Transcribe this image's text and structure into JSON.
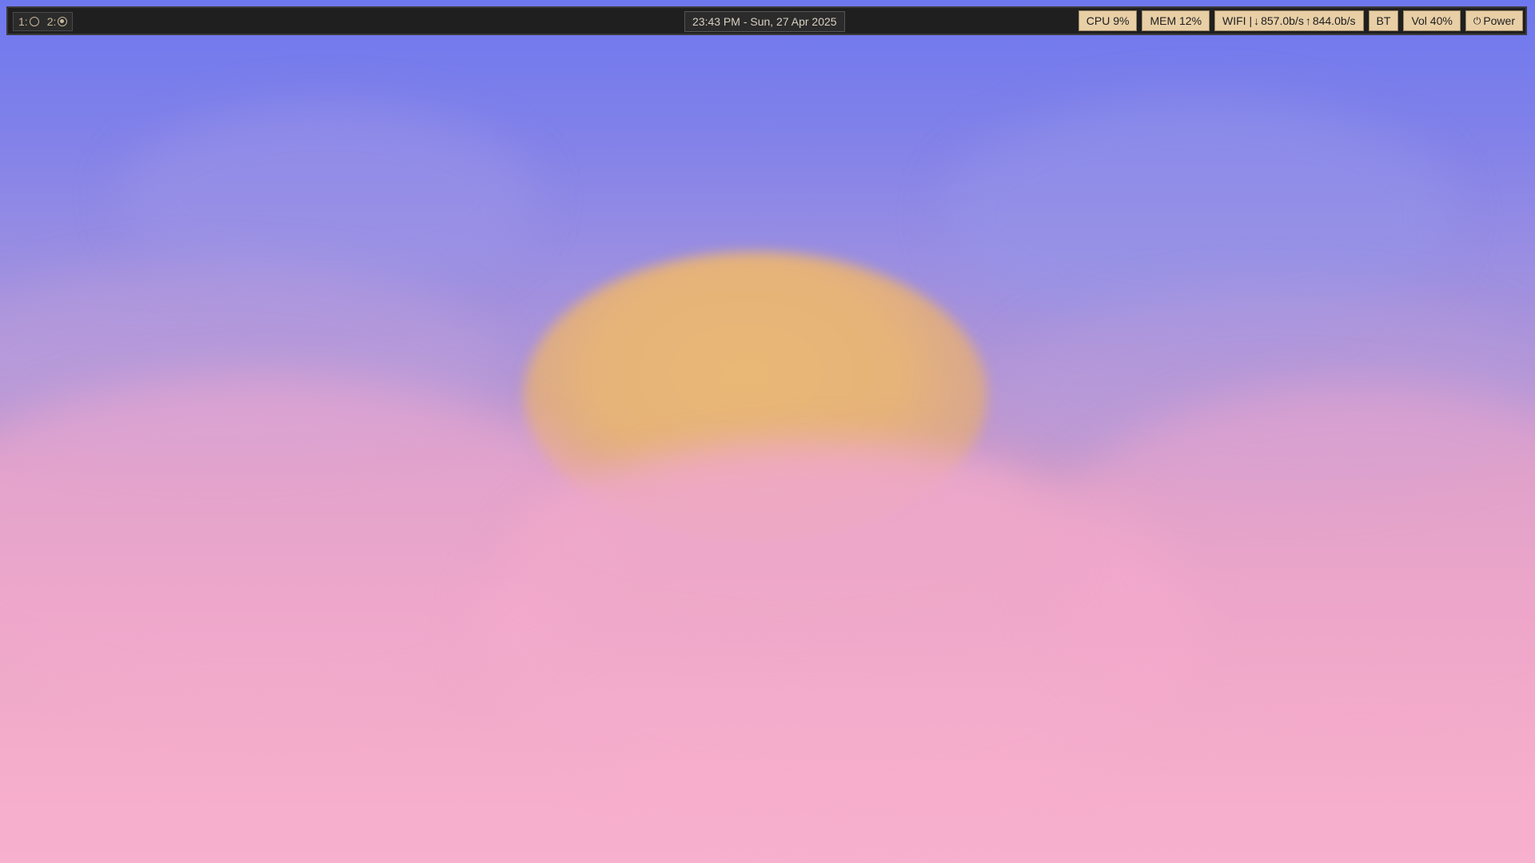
{
  "workspaces": [
    {
      "label": "1:",
      "icon": "empty-circle-icon",
      "active": false
    },
    {
      "label": "2:",
      "icon": "filled-circle-icon",
      "active": true
    }
  ],
  "clock": {
    "text": "23:43 PM - Sun, 27 Apr 2025"
  },
  "modules": {
    "cpu": "CPU 9%",
    "mem": "MEM 12%",
    "wifi": {
      "prefix": "WIFI |",
      "down_icon": "↓",
      "down": "857.0b/s",
      "up_icon": "↑",
      "up": "844.0b/s"
    },
    "bt": "BT",
    "vol": "Vol 40%",
    "power": {
      "icon": "⏻",
      "label": "Power"
    }
  },
  "colors": {
    "bar_bg": "#1f1f1f",
    "module_bg": "#e8cfa6",
    "workspace_fg": "#c8b89a",
    "sky_top": "#6e78ee",
    "sky_bottom": "#f6afcc",
    "sun": "#e9b876"
  }
}
